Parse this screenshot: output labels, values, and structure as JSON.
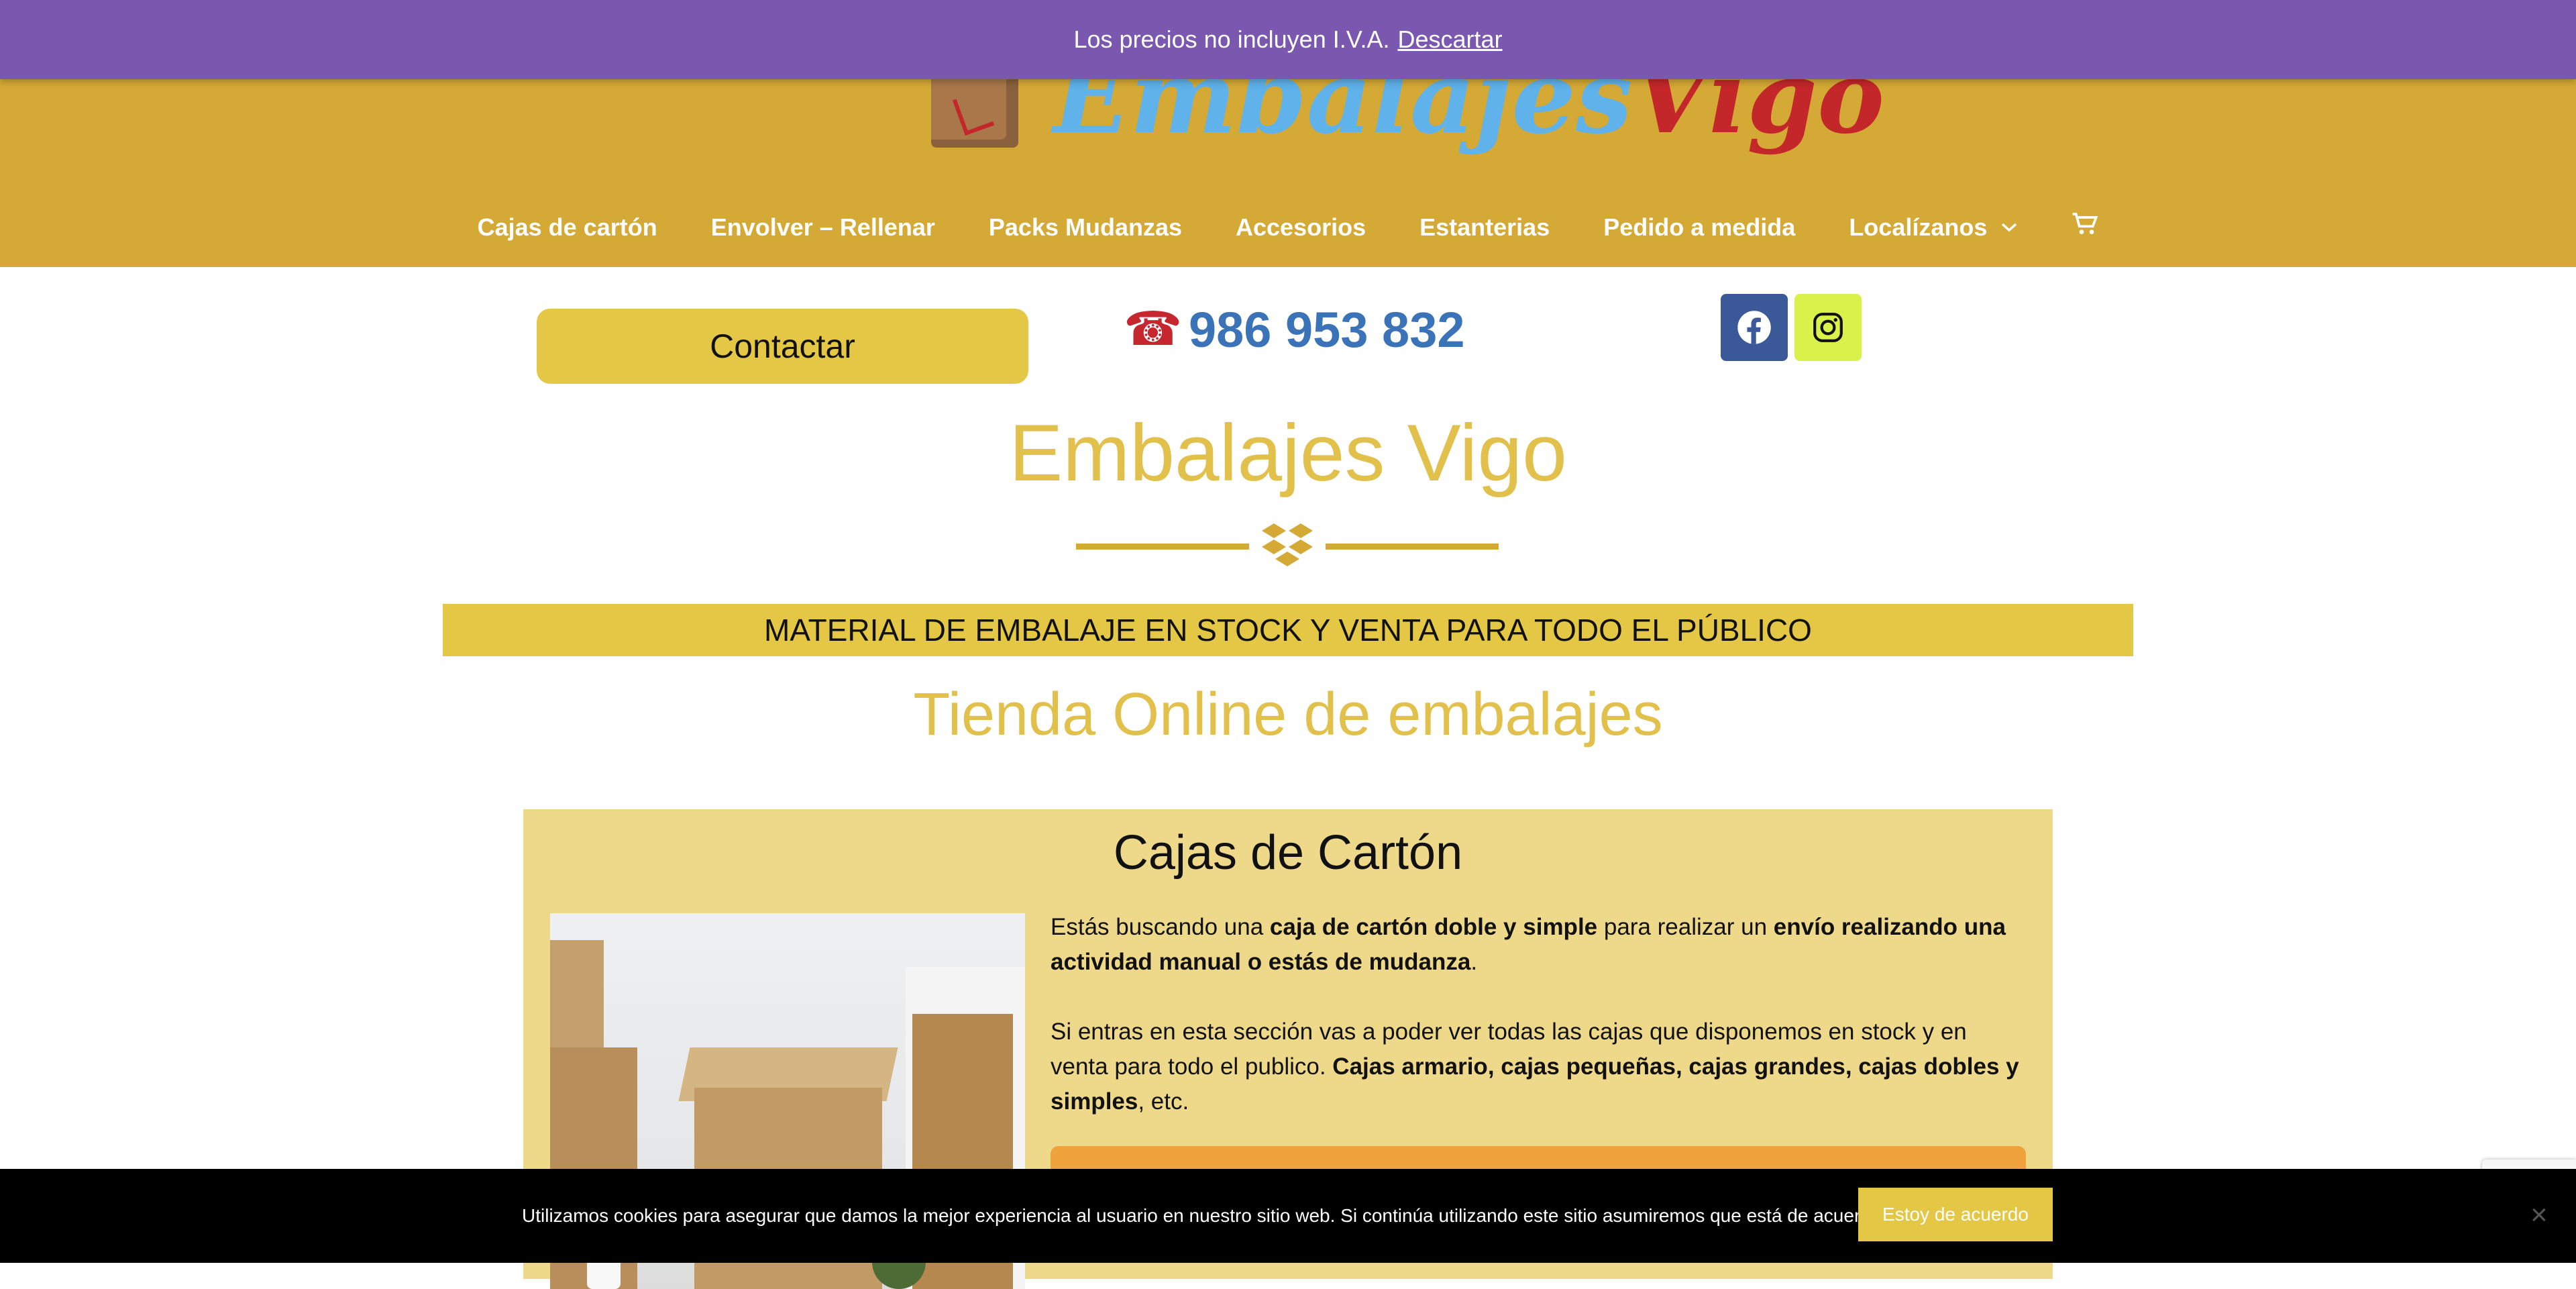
{
  "notice": {
    "text": "Los precios no incluyen I.V.A.",
    "dismiss_label": "Descartar",
    "background_color": "#7a58b0"
  },
  "header": {
    "background_color": "#d5a935",
    "logo": {
      "text_part1": "Embalajes",
      "text_part2": "Vigo"
    },
    "nav": [
      {
        "label": "Cajas de cartón"
      },
      {
        "label": "Envolver – Rellenar"
      },
      {
        "label": "Packs Mudanzas"
      },
      {
        "label": "Accesorios"
      },
      {
        "label": "Estanterias"
      },
      {
        "label": "Pedido a medida"
      },
      {
        "label": "Localízanos",
        "has_dropdown": true
      }
    ],
    "cart_icon": "cart-icon"
  },
  "contact": {
    "button_label": "Contactar",
    "phone_icon": "telephone-icon",
    "phone_number": "986 953 832",
    "social": [
      {
        "name": "facebook-icon",
        "color": "#3b5998"
      },
      {
        "name": "instagram-icon",
        "color": "#d9f24a"
      }
    ]
  },
  "main": {
    "site_title": "Embalajes Vigo",
    "banner": "MATERIAL DE EMBALAJE EN STOCK Y VENTA PARA TODO EL PÚBLICO",
    "shop_title": "Tienda Online de embalajes"
  },
  "card": {
    "title": "Cajas de Cartón",
    "p1": {
      "a": "Estás buscando una ",
      "b": "caja de cartón doble y simple",
      "c": " para realizar un ",
      "d": "envío realizando una actividad manual o estás de mudanza",
      "e": "."
    },
    "p2": {
      "a": " Si entras en esta sección vas a poder ver todas las cajas que disponemos en stock y en venta para todo el publico. ",
      "b": "Cajas armario, cajas pequeñas, cajas grandes, cajas dobles y simples",
      "c": ", etc."
    }
  },
  "cookie": {
    "text": "Utilizamos cookies para asegurar que damos la mejor experiencia al usuario en nuestro sitio web. Si continúa utilizando este sitio asumiremos que está de acuerdo.",
    "accept_label": "Estoy de acuerdo",
    "close_symbol": "×"
  }
}
